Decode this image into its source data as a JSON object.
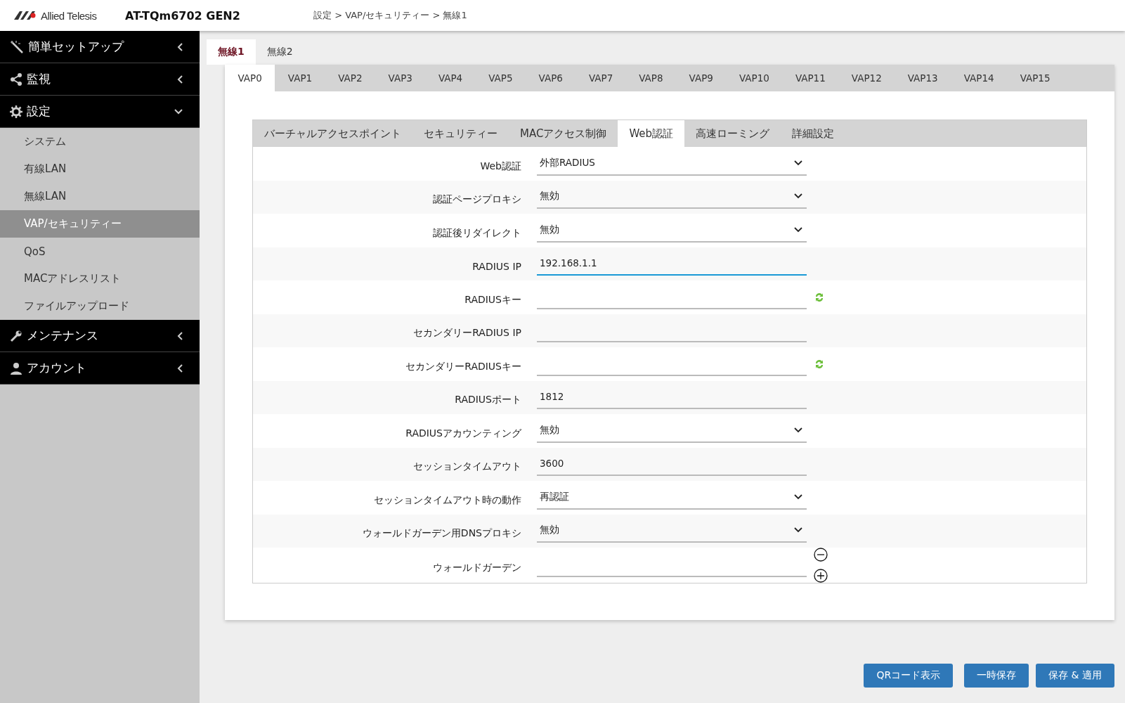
{
  "header": {
    "logo": "Allied Telesis",
    "model": "AT-TQm6702 GEN2",
    "breadcrumb": "設定 > VAP/セキュリティー > 無線1"
  },
  "sidebar": [
    {
      "label": "簡単セットアップ",
      "expanded": false
    },
    {
      "label": "監視",
      "expanded": false
    },
    {
      "label": "設定",
      "expanded": true,
      "children": [
        {
          "label": "システム",
          "selected": false
        },
        {
          "label": "有線LAN",
          "selected": false
        },
        {
          "label": "無線LAN",
          "selected": false
        },
        {
          "label": "VAP/セキュリティー",
          "selected": true
        },
        {
          "label": "QoS",
          "selected": false
        },
        {
          "label": "MACアドレスリスト",
          "selected": false
        },
        {
          "label": "ファイルアップロード",
          "selected": false
        }
      ]
    },
    {
      "label": "メンテナンス",
      "expanded": false
    },
    {
      "label": "アカウント",
      "expanded": false
    }
  ],
  "radio_tabs": [
    {
      "label": "無線1",
      "selected": true
    },
    {
      "label": "無線2",
      "selected": false
    }
  ],
  "vap_tabs": [
    {
      "label": "VAP0",
      "selected": true
    },
    {
      "label": "VAP1",
      "selected": false
    },
    {
      "label": "VAP2",
      "selected": false
    },
    {
      "label": "VAP3",
      "selected": false
    },
    {
      "label": "VAP4",
      "selected": false
    },
    {
      "label": "VAP5",
      "selected": false
    },
    {
      "label": "VAP6",
      "selected": false
    },
    {
      "label": "VAP7",
      "selected": false
    },
    {
      "label": "VAP8",
      "selected": false
    },
    {
      "label": "VAP9",
      "selected": false
    },
    {
      "label": "VAP10",
      "selected": false
    },
    {
      "label": "VAP11",
      "selected": false
    },
    {
      "label": "VAP12",
      "selected": false
    },
    {
      "label": "VAP13",
      "selected": false
    },
    {
      "label": "VAP14",
      "selected": false
    },
    {
      "label": "VAP15",
      "selected": false
    }
  ],
  "section_tabs": [
    {
      "label": "バーチャルアクセスポイント",
      "selected": false
    },
    {
      "label": "セキュリティー",
      "selected": false
    },
    {
      "label": "MACアクセス制御",
      "selected": false
    },
    {
      "label": "Web認証",
      "selected": true
    },
    {
      "label": "高速ローミング",
      "selected": false
    },
    {
      "label": "詳細設定",
      "selected": false
    }
  ],
  "fields": [
    {
      "label": "Web認証",
      "kind": "select",
      "value": "外部RADIUS",
      "focused": false
    },
    {
      "label": "認証ページプロキシ",
      "kind": "select",
      "value": "無効",
      "focused": false
    },
    {
      "label": "認証後リダイレクト",
      "kind": "select",
      "value": "無効",
      "focused": false
    },
    {
      "label": "RADIUS IP",
      "kind": "input",
      "value": "192.168.1.1",
      "focused": true
    },
    {
      "label": "RADIUSキー",
      "kind": "key",
      "focused": false
    },
    {
      "label": "セカンダリーRADIUS IP",
      "kind": "input",
      "focused": false
    },
    {
      "label": "セカンダリーRADIUSキー",
      "kind": "key",
      "focused": false
    },
    {
      "label": "RADIUSポート",
      "kind": "input",
      "value": "1812",
      "focused": false
    },
    {
      "label": "RADIUSアカウンティング",
      "kind": "select",
      "value": "無効",
      "focused": false
    },
    {
      "label": "セッションタイムアウト",
      "kind": "input",
      "value": "3600",
      "focused": false
    },
    {
      "label": "セッションタイムアウト時の動作",
      "kind": "select",
      "value": "再認証",
      "focused": false
    },
    {
      "label": "ウォールドガーデン用DNSプロキシ",
      "kind": "select",
      "value": "無効",
      "focused": false
    },
    {
      "label": "ウォールドガーデン",
      "kind": "list",
      "focused": false
    }
  ],
  "buttons": [
    "QRコード表示",
    "一時保存",
    "保存 & 適用"
  ]
}
